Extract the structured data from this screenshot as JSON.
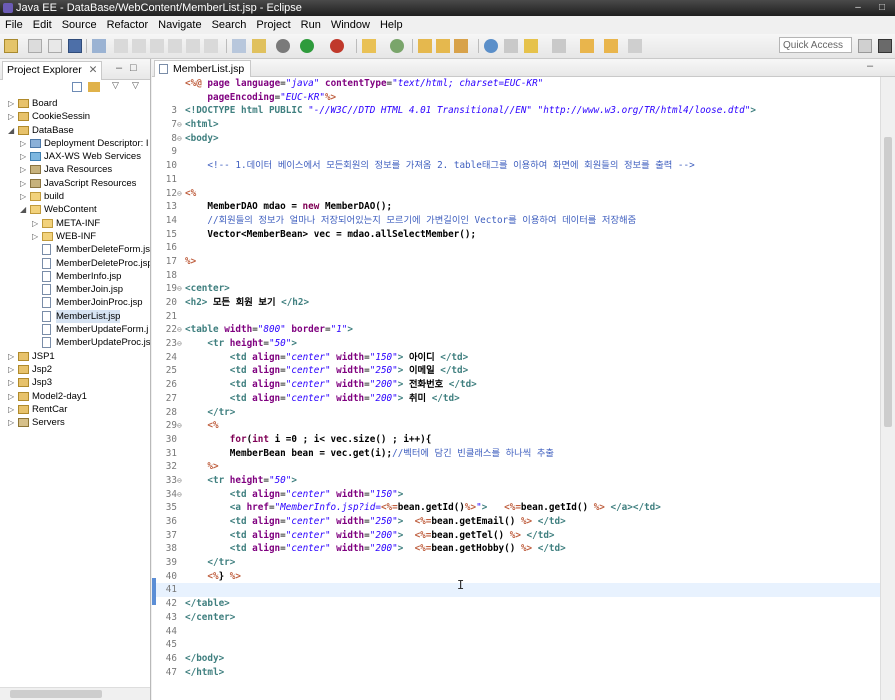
{
  "window": {
    "title": "Java EE - DataBase/WebContent/MemberList.jsp - Eclipse"
  },
  "menu": [
    "File",
    "Edit",
    "Source",
    "Refactor",
    "Navigate",
    "Search",
    "Project",
    "Run",
    "Window",
    "Help"
  ],
  "toolbar": {
    "quick_access_placeholder": "Quick Access"
  },
  "explorer": {
    "tab_label": "Project Explorer",
    "items": [
      {
        "label": "Board",
        "depth": 0,
        "icon": "project-icon",
        "twisty": "▷"
      },
      {
        "label": "CookieSessin",
        "depth": 0,
        "icon": "project-icon",
        "twisty": "▷"
      },
      {
        "label": "DataBase",
        "depth": 0,
        "icon": "project-icon",
        "twisty": "◢"
      },
      {
        "label": "Deployment Descriptor: I",
        "depth": 1,
        "icon": "descriptor-icon",
        "twisty": "▷"
      },
      {
        "label": "JAX-WS Web Services",
        "depth": 1,
        "icon": "webservice-icon",
        "twisty": "▷"
      },
      {
        "label": "Java Resources",
        "depth": 1,
        "icon": "java-resources-icon",
        "twisty": "▷"
      },
      {
        "label": "JavaScript Resources",
        "depth": 1,
        "icon": "js-resources-icon",
        "twisty": "▷"
      },
      {
        "label": "build",
        "depth": 1,
        "icon": "folder-icon",
        "twisty": "▷"
      },
      {
        "label": "WebContent",
        "depth": 1,
        "icon": "folder-icon",
        "twisty": "◢"
      },
      {
        "label": "META-INF",
        "depth": 2,
        "icon": "folder-icon",
        "twisty": "▷"
      },
      {
        "label": "WEB-INF",
        "depth": 2,
        "icon": "folder-icon",
        "twisty": "▷"
      },
      {
        "label": "MemberDeleteForm.js",
        "depth": 2,
        "icon": "jsp-file-icon",
        "twisty": ""
      },
      {
        "label": "MemberDeleteProc.jsp",
        "depth": 2,
        "icon": "jsp-file-icon",
        "twisty": ""
      },
      {
        "label": "MemberInfo.jsp",
        "depth": 2,
        "icon": "jsp-file-icon",
        "twisty": ""
      },
      {
        "label": "MemberJoin.jsp",
        "depth": 2,
        "icon": "jsp-file-icon",
        "twisty": ""
      },
      {
        "label": "MemberJoinProc.jsp",
        "depth": 2,
        "icon": "jsp-file-icon",
        "twisty": ""
      },
      {
        "label": "MemberList.jsp",
        "depth": 2,
        "icon": "jsp-file-icon",
        "twisty": "",
        "selected": true
      },
      {
        "label": "MemberUpdateForm.j",
        "depth": 2,
        "icon": "jsp-file-icon",
        "twisty": ""
      },
      {
        "label": "MemberUpdateProc.js",
        "depth": 2,
        "icon": "jsp-file-icon",
        "twisty": ""
      },
      {
        "label": "JSP1",
        "depth": 0,
        "icon": "project-icon",
        "twisty": "▷"
      },
      {
        "label": "Jsp2",
        "depth": 0,
        "icon": "project-icon",
        "twisty": "▷"
      },
      {
        "label": "Jsp3",
        "depth": 0,
        "icon": "project-icon",
        "twisty": "▷"
      },
      {
        "label": "Model2-day1",
        "depth": 0,
        "icon": "project-icon",
        "twisty": "▷"
      },
      {
        "label": "RentCar",
        "depth": 0,
        "icon": "project-icon",
        "twisty": "▷"
      },
      {
        "label": "Servers",
        "depth": 0,
        "icon": "servers-icon",
        "twisty": "▷"
      }
    ]
  },
  "editor": {
    "tab_label": "MemberList.jsp",
    "lines": [
      {
        "n": "",
        "fold": "",
        "segs": [
          [
            "m",
            "<%@ "
          ],
          [
            "a",
            "page "
          ],
          [
            "a",
            "language"
          ],
          [
            "n",
            "="
          ],
          [
            "s",
            "\"java\" "
          ],
          [
            "a",
            "contentType"
          ],
          [
            "n",
            "="
          ],
          [
            "s",
            "\"text/html; charset=EUC-KR\""
          ]
        ]
      },
      {
        "n": "",
        "fold": "",
        "segs": [
          [
            "n",
            "    "
          ],
          [
            "a",
            "pageEncoding"
          ],
          [
            "n",
            "="
          ],
          [
            "s",
            "\"EUC-KR\""
          ],
          [
            "m",
            "%>"
          ]
        ]
      },
      {
        "n": "3",
        "fold": "",
        "segs": [
          [
            "t",
            "<!DOCTYPE html PUBLIC "
          ],
          [
            "s",
            "\"-//W3C//DTD HTML 4.01 Transitional//EN\" \"http://www.w3.org/TR/html4/loose.dtd\""
          ],
          [
            "t",
            ">"
          ]
        ]
      },
      {
        "n": "7",
        "fold": "⊖",
        "segs": [
          [
            "t",
            "<html>"
          ]
        ]
      },
      {
        "n": "8",
        "fold": "⊖",
        "segs": [
          [
            "t",
            "<body>"
          ]
        ]
      },
      {
        "n": "9",
        "fold": "",
        "segs": []
      },
      {
        "n": "10",
        "fold": "",
        "segs": [
          [
            "n",
            "    "
          ],
          [
            "c",
            "<!-- 1.데이터 베이스에서 모든회원의 정보를 가져옴 2. table태그를 이용하여 화면에 회원들의 정보를 출력 -->"
          ]
        ]
      },
      {
        "n": "11",
        "fold": "",
        "segs": []
      },
      {
        "n": "12",
        "fold": "⊖",
        "segs": [
          [
            "m",
            "<%"
          ]
        ]
      },
      {
        "n": "13",
        "fold": "",
        "segs": [
          [
            "n",
            "    "
          ],
          [
            "j",
            "MemberDAO mdao = "
          ],
          [
            "k",
            "new "
          ],
          [
            "j",
            "MemberDAO();"
          ]
        ]
      },
      {
        "n": "14",
        "fold": "",
        "segs": [
          [
            "n",
            "    "
          ],
          [
            "c",
            "//회원들의 정보가 얼마나 저장되어있는지 모르기에 가변길이인 Vector를 이용하여 데이터를 저장해줌"
          ]
        ]
      },
      {
        "n": "15",
        "fold": "",
        "segs": [
          [
            "n",
            "    "
          ],
          [
            "j",
            "Vector<MemberBean> vec = mdao.allSelectMember();"
          ]
        ]
      },
      {
        "n": "16",
        "fold": "",
        "segs": []
      },
      {
        "n": "17",
        "fold": "",
        "segs": [
          [
            "m",
            "%>"
          ]
        ]
      },
      {
        "n": "18",
        "fold": "",
        "segs": []
      },
      {
        "n": "19",
        "fold": "⊖",
        "segs": [
          [
            "t",
            "<center>"
          ]
        ]
      },
      {
        "n": "20",
        "fold": "",
        "segs": [
          [
            "t",
            "<h2>"
          ],
          [
            "j",
            " 모든 회원 보기 "
          ],
          [
            "t",
            "</h2>"
          ]
        ]
      },
      {
        "n": "21",
        "fold": "",
        "segs": []
      },
      {
        "n": "22",
        "fold": "⊖",
        "segs": [
          [
            "t",
            "<table "
          ],
          [
            "a",
            "width"
          ],
          [
            "n",
            "="
          ],
          [
            "s",
            "\"800\" "
          ],
          [
            "a",
            "border"
          ],
          [
            "n",
            "="
          ],
          [
            "s",
            "\"1\""
          ],
          [
            "t",
            ">"
          ]
        ]
      },
      {
        "n": "23",
        "fold": "⊖",
        "segs": [
          [
            "n",
            "    "
          ],
          [
            "t",
            "<tr "
          ],
          [
            "a",
            "height"
          ],
          [
            "n",
            "="
          ],
          [
            "s",
            "\"50\""
          ],
          [
            "t",
            ">"
          ]
        ]
      },
      {
        "n": "24",
        "fold": "",
        "segs": [
          [
            "n",
            "        "
          ],
          [
            "t",
            "<td "
          ],
          [
            "a",
            "align"
          ],
          [
            "n",
            "="
          ],
          [
            "s",
            "\"center\" "
          ],
          [
            "a",
            "width"
          ],
          [
            "n",
            "="
          ],
          [
            "s",
            "\"150\""
          ],
          [
            "t",
            "> "
          ],
          [
            "j",
            "아이디 "
          ],
          [
            "t",
            "</td>"
          ]
        ]
      },
      {
        "n": "25",
        "fold": "",
        "segs": [
          [
            "n",
            "        "
          ],
          [
            "t",
            "<td "
          ],
          [
            "a",
            "align"
          ],
          [
            "n",
            "="
          ],
          [
            "s",
            "\"center\" "
          ],
          [
            "a",
            "width"
          ],
          [
            "n",
            "="
          ],
          [
            "s",
            "\"250\""
          ],
          [
            "t",
            "> "
          ],
          [
            "j",
            "이메일 "
          ],
          [
            "t",
            "</td>"
          ]
        ]
      },
      {
        "n": "26",
        "fold": "",
        "segs": [
          [
            "n",
            "        "
          ],
          [
            "t",
            "<td "
          ],
          [
            "a",
            "align"
          ],
          [
            "n",
            "="
          ],
          [
            "s",
            "\"center\" "
          ],
          [
            "a",
            "width"
          ],
          [
            "n",
            "="
          ],
          [
            "s",
            "\"200\""
          ],
          [
            "t",
            "> "
          ],
          [
            "j",
            "전화번호 "
          ],
          [
            "t",
            "</td>"
          ]
        ]
      },
      {
        "n": "27",
        "fold": "",
        "segs": [
          [
            "n",
            "        "
          ],
          [
            "t",
            "<td "
          ],
          [
            "a",
            "align"
          ],
          [
            "n",
            "="
          ],
          [
            "s",
            "\"center\" "
          ],
          [
            "a",
            "width"
          ],
          [
            "n",
            "="
          ],
          [
            "s",
            "\"200\""
          ],
          [
            "t",
            "> "
          ],
          [
            "j",
            "취미 "
          ],
          [
            "t",
            "</td>"
          ]
        ]
      },
      {
        "n": "28",
        "fold": "",
        "segs": [
          [
            "n",
            "    "
          ],
          [
            "t",
            "</tr>"
          ]
        ]
      },
      {
        "n": "29",
        "fold": "⊖",
        "segs": [
          [
            "n",
            "    "
          ],
          [
            "m",
            "<%"
          ]
        ]
      },
      {
        "n": "30",
        "fold": "",
        "segs": [
          [
            "n",
            "        "
          ],
          [
            "k",
            "for"
          ],
          [
            "j",
            "("
          ],
          [
            "k",
            "int "
          ],
          [
            "j",
            "i =0 ; i< vec.size() ; i++){"
          ]
        ]
      },
      {
        "n": "31",
        "fold": "",
        "segs": [
          [
            "n",
            "        "
          ],
          [
            "j",
            "MemberBean bean = vec.get(i);"
          ],
          [
            "c",
            "//벡터에 담긴 빈클래스를 하나씩 추출"
          ]
        ]
      },
      {
        "n": "32",
        "fold": "",
        "segs": [
          [
            "n",
            "    "
          ],
          [
            "m",
            "%>"
          ]
        ]
      },
      {
        "n": "33",
        "fold": "⊖",
        "segs": [
          [
            "n",
            "    "
          ],
          [
            "t",
            "<tr "
          ],
          [
            "a",
            "height"
          ],
          [
            "n",
            "="
          ],
          [
            "s",
            "\"50\""
          ],
          [
            "t",
            ">"
          ]
        ]
      },
      {
        "n": "34",
        "fold": "⊖",
        "segs": [
          [
            "n",
            "        "
          ],
          [
            "t",
            "<td "
          ],
          [
            "a",
            "align"
          ],
          [
            "n",
            "="
          ],
          [
            "s",
            "\"center\" "
          ],
          [
            "a",
            "width"
          ],
          [
            "n",
            "="
          ],
          [
            "s",
            "\"150\""
          ],
          [
            "t",
            ">"
          ]
        ]
      },
      {
        "n": "35",
        "fold": "",
        "segs": [
          [
            "n",
            "        "
          ],
          [
            "t",
            "<a "
          ],
          [
            "a",
            "href"
          ],
          [
            "n",
            "="
          ],
          [
            "s",
            "\"MemberInfo.jsp?id="
          ],
          [
            "m",
            "<%="
          ],
          [
            "j",
            "bean.getId()"
          ],
          [
            "m",
            "%>"
          ],
          [
            "s",
            "\""
          ],
          [
            "t",
            ">"
          ],
          [
            "n",
            "   "
          ],
          [
            "m",
            "<%="
          ],
          [
            "j",
            "bean.getId() "
          ],
          [
            "m",
            "%> "
          ],
          [
            "t",
            "</a></td>"
          ]
        ]
      },
      {
        "n": "36",
        "fold": "",
        "segs": [
          [
            "n",
            "        "
          ],
          [
            "t",
            "<td "
          ],
          [
            "a",
            "align"
          ],
          [
            "n",
            "="
          ],
          [
            "s",
            "\"center\" "
          ],
          [
            "a",
            "width"
          ],
          [
            "n",
            "="
          ],
          [
            "s",
            "\"250\""
          ],
          [
            "t",
            ">"
          ],
          [
            "n",
            "  "
          ],
          [
            "m",
            "<%="
          ],
          [
            "j",
            "bean.getEmail() "
          ],
          [
            "m",
            "%> "
          ],
          [
            "t",
            "</td>"
          ]
        ]
      },
      {
        "n": "37",
        "fold": "",
        "segs": [
          [
            "n",
            "        "
          ],
          [
            "t",
            "<td "
          ],
          [
            "a",
            "align"
          ],
          [
            "n",
            "="
          ],
          [
            "s",
            "\"center\" "
          ],
          [
            "a",
            "width"
          ],
          [
            "n",
            "="
          ],
          [
            "s",
            "\"200\""
          ],
          [
            "t",
            ">"
          ],
          [
            "n",
            "  "
          ],
          [
            "m",
            "<%="
          ],
          [
            "j",
            "bean.getTel() "
          ],
          [
            "m",
            "%> "
          ],
          [
            "t",
            "</td>"
          ]
        ]
      },
      {
        "n": "38",
        "fold": "",
        "segs": [
          [
            "n",
            "        "
          ],
          [
            "t",
            "<td "
          ],
          [
            "a",
            "align"
          ],
          [
            "n",
            "="
          ],
          [
            "s",
            "\"center\" "
          ],
          [
            "a",
            "width"
          ],
          [
            "n",
            "="
          ],
          [
            "s",
            "\"200\""
          ],
          [
            "t",
            ">"
          ],
          [
            "n",
            "  "
          ],
          [
            "m",
            "<%="
          ],
          [
            "j",
            "bean.getHobby() "
          ],
          [
            "m",
            "%> "
          ],
          [
            "t",
            "</td>"
          ]
        ]
      },
      {
        "n": "39",
        "fold": "",
        "segs": [
          [
            "n",
            "    "
          ],
          [
            "t",
            "</tr>"
          ]
        ]
      },
      {
        "n": "40",
        "fold": "",
        "segs": [
          [
            "n",
            "    "
          ],
          [
            "m",
            "<%"
          ],
          [
            "j",
            "} "
          ],
          [
            "m",
            "%>"
          ]
        ]
      },
      {
        "n": "41",
        "fold": "",
        "segs": [],
        "current": true
      },
      {
        "n": "42",
        "fold": "",
        "segs": [
          [
            "t",
            "</table>"
          ]
        ]
      },
      {
        "n": "43",
        "fold": "",
        "segs": [
          [
            "t",
            "</center>"
          ]
        ]
      },
      {
        "n": "44",
        "fold": "",
        "segs": []
      },
      {
        "n": "45",
        "fold": "",
        "segs": []
      },
      {
        "n": "46",
        "fold": "",
        "segs": [
          [
            "t",
            "</body>"
          ]
        ]
      },
      {
        "n": "47",
        "fold": "",
        "segs": [
          [
            "t",
            "</html>"
          ]
        ]
      }
    ]
  }
}
